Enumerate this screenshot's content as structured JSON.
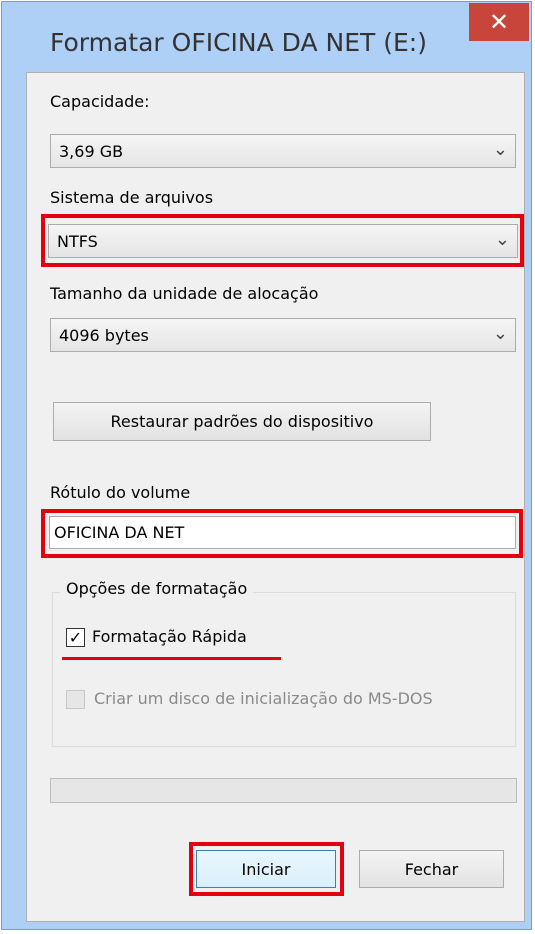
{
  "window": {
    "title": "Formatar OFICINA DA NET (E:)",
    "close_symbol": "✕"
  },
  "capacity": {
    "label": "Capacidade:",
    "value": "3,69 GB"
  },
  "filesystem": {
    "label": "Sistema de arquivos",
    "value": "NTFS"
  },
  "allocation": {
    "label": "Tamanho da unidade de alocação",
    "value": "4096 bytes"
  },
  "restore_button": "Restaurar padrões do dispositivo",
  "volume": {
    "label": "Rótulo do volume",
    "value": "OFICINA DA NET"
  },
  "options": {
    "title": "Opções de formatação",
    "quick_format": {
      "label": "Formatação Rápida",
      "checked": true
    },
    "msdos": {
      "label": "Criar um disco de inicialização do MS-DOS",
      "checked": false,
      "enabled": false
    }
  },
  "progress": 0,
  "buttons": {
    "start": "Iniciar",
    "close": "Fechar"
  },
  "colors": {
    "highlight": "#e3000f",
    "title_bar": "#aecff6",
    "close_button": "#c7453b"
  }
}
